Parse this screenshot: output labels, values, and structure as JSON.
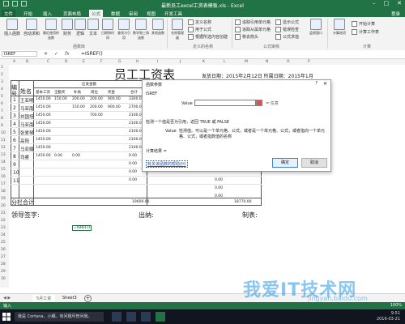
{
  "window": {
    "title": "最新员工excel工资表模板.xls - Excel"
  },
  "tabs": [
    "文件",
    "开始",
    "插入",
    "页面布局",
    "公式",
    "数据",
    "审阅",
    "视图",
    "开发工具"
  ],
  "login_label": "登录",
  "ribbon": {
    "insert_function": "插入函数",
    "autosum": "自动求和",
    "recent": "最近使用的函数",
    "financial": "财务",
    "logical": "逻辑",
    "text": "文本",
    "datetime": "日期和时间",
    "lookup": "查找与引用",
    "math": "数学和三角函数",
    "other": "其他函数",
    "group_library": "函数库",
    "name_manager": "名称管理器",
    "define_name": "定义名称",
    "use_in_formula": "用于公式",
    "create_from_sel": "根据所选内容创建",
    "group_names": "定义的名称",
    "trace_prec": "追踪引用单元格",
    "trace_dep": "追踪从属单元格",
    "remove_arrows": "移去箭头",
    "show_formulas": "显示公式",
    "error_check": "错误检查",
    "eval_formula": "公式求值",
    "group_audit": "公式审核",
    "watch": "监视窗口",
    "calc_options": "计算选项",
    "calc_now": "开始计算",
    "calc_sheet": "计算工作表",
    "group_calc": "计算"
  },
  "formula_bar": {
    "name_box": "ISREF",
    "cancel": "✕",
    "enter": "✓",
    "fx": "fx",
    "formula": "=ISREF()"
  },
  "columns": [
    "A",
    "B",
    "C",
    "D",
    "E",
    "F",
    "G",
    "H",
    "I",
    "J",
    "K",
    "L",
    "M",
    "N",
    "O",
    "P"
  ],
  "rows": [
    "1",
    "2",
    "3",
    "4",
    "5",
    "6",
    "7",
    "8",
    "9",
    "10",
    "11",
    "12",
    "13",
    "14",
    "15",
    "16",
    "17",
    "18",
    "19",
    "20",
    "21",
    "22",
    "23",
    "24",
    "25",
    "26",
    "27",
    "28",
    "29",
    "30"
  ],
  "sheet": {
    "title": "员工工资表",
    "issue_date": "发放日期：2015年2月12日  所属日期：2015年1月",
    "col_no": "编号",
    "col_name": "姓名",
    "col_payable": "应发金额",
    "sub_headers": [
      "基本工资",
      "全勤奖",
      "补助",
      "岗位",
      "奖金",
      "合计"
    ],
    "employees": [
      {
        "no": "1",
        "name": "王亚明",
        "v": [
          "1450.00",
          "150.00",
          "200.00",
          "200.00",
          "900.00",
          "3300.00"
        ]
      },
      {
        "no": "2",
        "name": "马亚南",
        "v": [
          "1450.00",
          "",
          "150.00",
          "200.00",
          "900.00",
          "2700.00"
        ]
      },
      {
        "no": "3",
        "name": "刘国坦",
        "v": [
          "1450.00",
          "",
          "",
          "700.00",
          "",
          "2100.00"
        ]
      },
      {
        "no": "4",
        "name": "马亚南",
        "v": [
          "1450.00",
          "",
          "",
          "",
          "",
          "2100.00"
        ]
      },
      {
        "no": "5",
        "name": "张爱琴",
        "v": [
          "1450.00",
          "",
          "",
          "",
          "",
          "2100.00"
        ]
      },
      {
        "no": "6",
        "name": "高阳",
        "v": [
          "1450.00",
          "",
          "",
          "",
          "",
          "2100.00"
        ]
      },
      {
        "no": "7",
        "name": "马亚娟",
        "v": [
          "1450.00",
          "",
          "",
          "",
          "",
          "2100.00"
        ]
      },
      {
        "no": "8",
        "name": "司睿",
        "v": [
          "1450.00",
          "0.00",
          "0.00",
          "",
          "",
          "0.00"
        ]
      },
      {
        "no": "9",
        "name": "",
        "v": [
          "",
          "",
          "",
          "",
          "",
          "0.00"
        ]
      },
      {
        "no": "10",
        "name": "",
        "v": [
          "",
          "",
          "",
          "",
          "",
          "0.00"
        ]
      },
      {
        "no": "11",
        "name": "",
        "v": [
          "",
          "",
          "",
          "",
          "",
          "0.00"
        ]
      }
    ],
    "extra_col_values": [
      "0.00",
      "0.00",
      "0.00"
    ],
    "subtotal_label": "分栏合计",
    "subtotal_total": "19600.00",
    "subtotal_right": "18770.00",
    "sign_leader": "领导签字:",
    "sign_cashier": "出纳:",
    "sign_maker": "制表:",
    "active_cell": "=ISREF()"
  },
  "dialog": {
    "title": "函数参数",
    "help": "?",
    "close": "✕",
    "function_name": "ISREF",
    "value_label": "Value",
    "value_result": "= 任意",
    "desc_main": "检测一个值是否为引用，返回 TRUE 或 FALSE",
    "desc_value_label": "Value",
    "desc_value": "检测值。可以是一个单元格、公式，或者是一个单元格、公式，或者指向一个单元格、公式，或者指数值的名称",
    "calc_result": "计算结果 =",
    "help_link": "有关该函数的帮助(H)",
    "ok": "确定",
    "cancel": "取消"
  },
  "sheet_tabs": [
    "5月工资",
    "Sheet3"
  ],
  "status": {
    "ready": "输入",
    "zoom": "100%"
  },
  "taskbar": {
    "search": "我是 Cortana，小娜。有问题尽管问我。",
    "time": "9:51",
    "date": "2016-03-21"
  },
  "watermark": {
    "main": "我爱IT技术网",
    "sub": "jingyan.baidu.com"
  },
  "colors": {
    "excel_green": "#217346",
    "grid": "#e2e2e2"
  }
}
